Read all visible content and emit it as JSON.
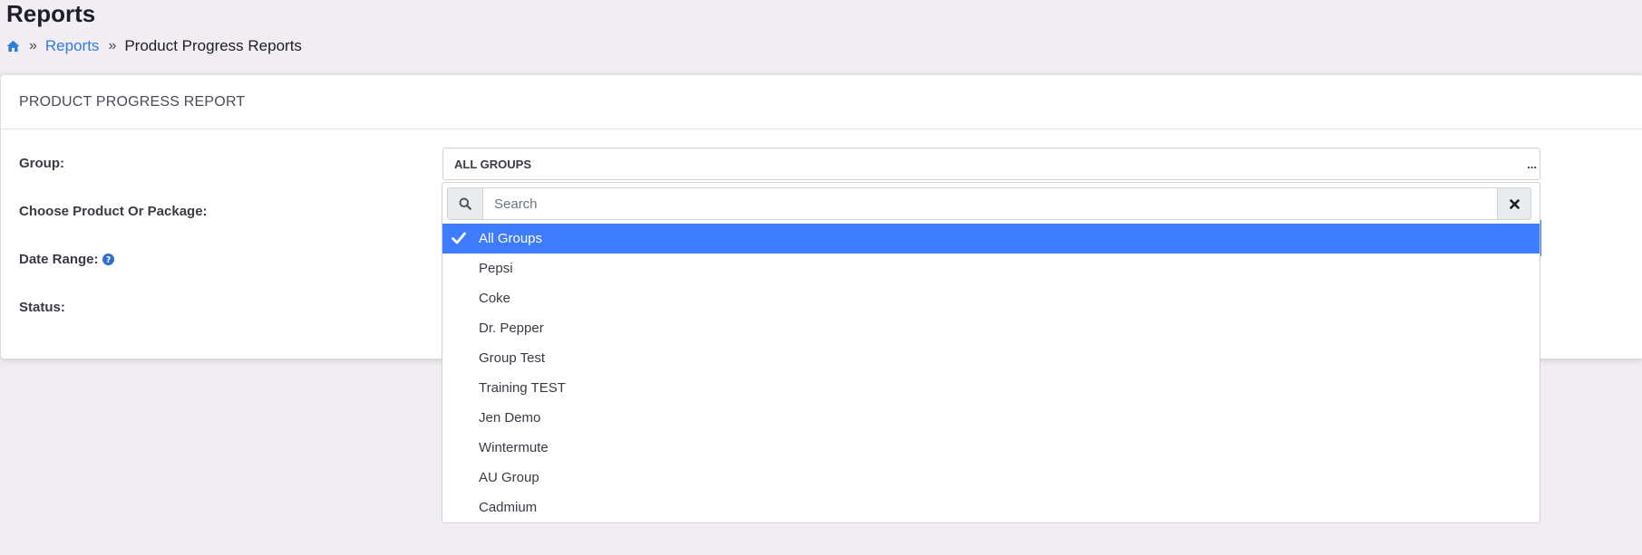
{
  "page": {
    "title": "Reports"
  },
  "breadcrumb": {
    "home_icon": "home-icon",
    "items": [
      "Reports",
      "Product Progress Reports"
    ]
  },
  "card": {
    "title": "PRODUCT PROGRESS REPORT"
  },
  "form": {
    "labels": {
      "group": "Group:",
      "product": "Choose Product Or Package:",
      "date_range": "Date Range:",
      "status": "Status:"
    },
    "group_select": {
      "value": "ALL GROUPS",
      "ellipsis": "..."
    }
  },
  "dropdown": {
    "search_placeholder": "Search",
    "search_icon": "search-icon",
    "clear_icon": "close-icon",
    "options": [
      {
        "label": "All Groups",
        "selected": true
      },
      {
        "label": "Pepsi",
        "selected": false
      },
      {
        "label": "Coke",
        "selected": false
      },
      {
        "label": "Dr. Pepper",
        "selected": false
      },
      {
        "label": "Group Test",
        "selected": false
      },
      {
        "label": "Training TEST",
        "selected": false
      },
      {
        "label": "Jen Demo",
        "selected": false
      },
      {
        "label": "Wintermute",
        "selected": false
      },
      {
        "label": "AU Group",
        "selected": false
      },
      {
        "label": "Cadmium",
        "selected": false
      }
    ]
  },
  "colors": {
    "accent": "#3d7cff",
    "link": "#2f7de1",
    "background": "#f1edf2"
  }
}
